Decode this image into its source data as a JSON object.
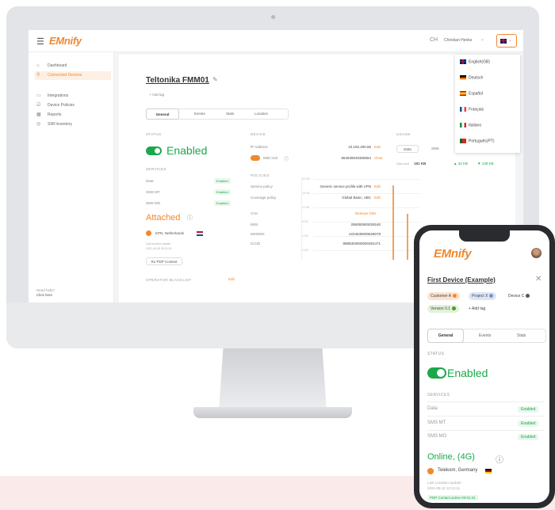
{
  "app": {
    "logo": "EMnify",
    "user_badge": "CH",
    "user_name": "Christian Henke",
    "languages": [
      "English(GB)",
      "Deutsch",
      "Español",
      "Français",
      "Italiano",
      "Português(PT)"
    ]
  },
  "sidebar": {
    "items": [
      {
        "label": "Dashboard",
        "icon": "home-icon",
        "active": false
      },
      {
        "label": "Connected Devices",
        "icon": "devices-icon",
        "active": true
      },
      {
        "label": "Integrations",
        "icon": "integrations-icon",
        "active": false
      },
      {
        "label": "Device Policies",
        "icon": "policy-icon",
        "active": false
      },
      {
        "label": "Reports",
        "icon": "reports-icon",
        "active": false
      },
      {
        "label": "SIM Inventory",
        "icon": "sim-icon",
        "active": false
      }
    ],
    "help_title": "Need help?",
    "help_link": "Click here"
  },
  "device": {
    "title": "Teltonika FMM01",
    "add_tag": "+ Add tag",
    "tabs": [
      "General",
      "Events",
      "Stats",
      "Location"
    ],
    "status_label": "STATUS",
    "status": "Enabled",
    "services_label": "SERVICES",
    "services": [
      {
        "name": "Data",
        "state": "Enabled"
      },
      {
        "name": "SMS MT",
        "state": "Enabled"
      },
      {
        "name": "SMS MO",
        "state": "Enabled"
      }
    ],
    "connection": "Attached",
    "network": "KPN, Netherlands",
    "last_update_label": "Last location update",
    "last_update": "2021-06-05 05:31:15",
    "pdp_button": "Ro PDP Context",
    "blacklist_label": "OPERATOR BLACKLIST",
    "blacklist_edit": "Edit"
  },
  "device_info": {
    "section_label": "DEVICE",
    "ip_label": "IP Address",
    "ip_value": "10.192.200.56",
    "ip_edit": "Edit",
    "imei_lock": "IMEI lock",
    "imei_value": "864939049305654",
    "imei_action": "Clear",
    "policies_label": "POLICIES",
    "service_policy_label": "Service policy",
    "service_policy_value": "Generic service profile with VPN",
    "service_policy_edit": "Edit",
    "coverage_policy_label": "Coverage policy",
    "coverage_policy_value": "Global Basic, ABC",
    "coverage_policy_edit": "Edit",
    "sim_label": "SIM",
    "sim_action": "Release SIM",
    "imsi_label": "IMSI",
    "imsi_value": "295050900029160",
    "msisdn_label": "MSISDN",
    "msisdn_value": "4234639000628078",
    "iccid_label": "ICCID",
    "iccid_value": "8988303000000481471"
  },
  "usage": {
    "section_label": "USAGE",
    "tabs": [
      "Data",
      "SMS",
      "LAST HOUR"
    ],
    "data_used_label": "Data used",
    "data_used": "181 KB",
    "upload": "▲ 42 KB",
    "download": "▼ 138 KB",
    "y_ticks": [
      "20 KB",
      "16 KB",
      "12 KB",
      "8 KB",
      "4 KB",
      "2 KB"
    ]
  },
  "phone": {
    "logo": "EMnify",
    "title": "First Device (Example)",
    "tags": [
      "Customer A",
      "Project X",
      "Device C",
      "Version 0.1"
    ],
    "add_tag": "+ Add tag",
    "tabs": [
      "General",
      "Events",
      "Stats"
    ],
    "status_label": "STATUS",
    "status": "Enabled",
    "services_label": "SERVICES",
    "services": [
      {
        "name": "Data",
        "state": "Enabled"
      },
      {
        "name": "SMS MT",
        "state": "Enabled"
      },
      {
        "name": "SMS MO",
        "state": "Enabled"
      }
    ],
    "connection": "Online, (4G)",
    "network": "Telekom, Germany",
    "last_update_label": "Last Location Update:",
    "last_update": "2021-05-11 10:21:11",
    "pdp_contact": "PDP Contact active 00:01:41"
  },
  "colors": {
    "brand_orange": "#f0882e",
    "status_green": "#1ba84a"
  }
}
